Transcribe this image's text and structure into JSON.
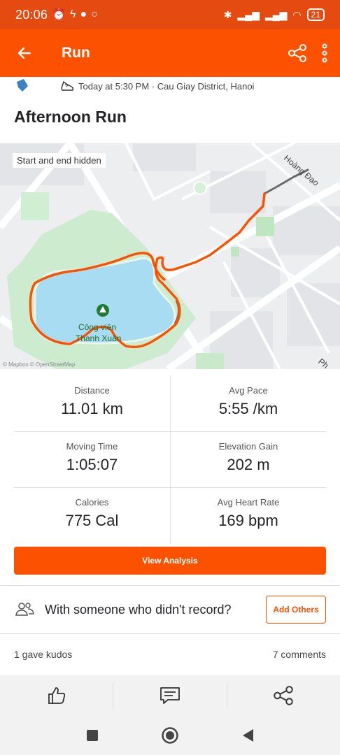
{
  "status_bar": {
    "time": "20:06",
    "battery": "21"
  },
  "app_bar": {
    "title": "Run"
  },
  "activity": {
    "meta": "Today at 5:30 PM · Cau Giay District, Hanoi",
    "title": "Afternoon Run"
  },
  "map": {
    "overlay_label": "Start and end hidden",
    "attribution": "© Mapbox © OpenStreetMap",
    "street_label": "Hoàng Đạo",
    "street_label_2": "Ph",
    "park_label_1": "Công viên",
    "park_label_2": "Thanh Xuân",
    "route_color": "#fc5200",
    "hidden_route_color": "#6b6b6b",
    "park_color": "#cdeccf",
    "lake_color": "#a8dcf2"
  },
  "stats": [
    {
      "label": "Distance",
      "value": "11.01 km"
    },
    {
      "label": "Avg Pace",
      "value": "5:55 /km"
    },
    {
      "label": "Moving Time",
      "value": "1:05:07"
    },
    {
      "label": "Elevation Gain",
      "value": "202 m"
    },
    {
      "label": "Calories",
      "value": "775 Cal"
    },
    {
      "label": "Avg Heart Rate",
      "value": "169 bpm"
    }
  ],
  "buttons": {
    "view_analysis": "View Analysis",
    "add_others": "Add Others"
  },
  "others_prompt": "With someone who didn't record?",
  "kudos_text": "1 gave kudos",
  "comments_text": "7 comments",
  "icons": {
    "back": "arrow-left-icon",
    "share": "share-icon",
    "more": "more-vert-icon",
    "like": "thumbs-up-icon",
    "comment": "comment-icon"
  },
  "accent_color": "#fc5200"
}
